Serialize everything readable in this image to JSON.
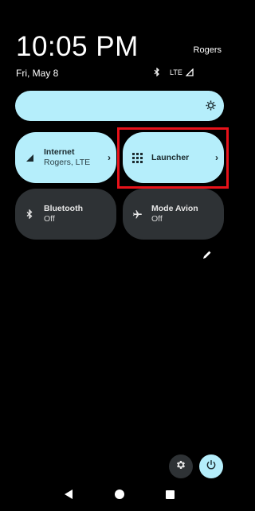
{
  "header": {
    "time": "10:05 PM",
    "carrier": "Rogers",
    "date": "Fri, May 8",
    "network": "LTE"
  },
  "icons": {
    "bluetooth_status": "bluetooth-icon",
    "signal": "signal-icon",
    "brightness": "brightness-icon"
  },
  "tiles": [
    {
      "title": "Internet",
      "subtitle": "Rogers, LTE",
      "icon": "signal-icon",
      "state": "on"
    },
    {
      "title": "Launcher",
      "subtitle": "",
      "icon": "grid-icon",
      "state": "on"
    },
    {
      "title": "Bluetooth",
      "subtitle": "Off",
      "icon": "bluetooth-icon",
      "state": "off"
    },
    {
      "title": "Mode Avion",
      "subtitle": "Off",
      "icon": "airplane-icon",
      "state": "off"
    }
  ],
  "colors": {
    "tile_on": "#b5eefb",
    "tile_off": "#2e3235",
    "highlight": "#e8121a",
    "background": "#000000"
  }
}
